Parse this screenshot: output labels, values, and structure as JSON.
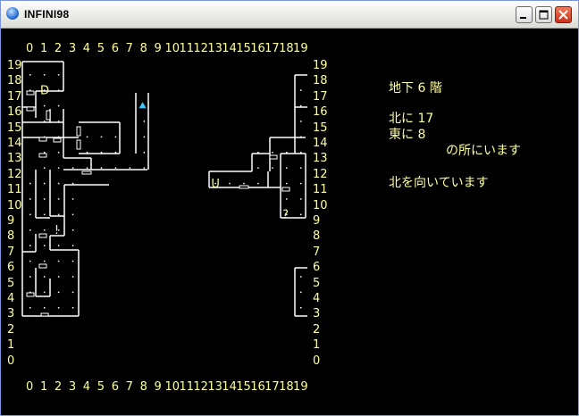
{
  "window": {
    "title": "INFINI98"
  },
  "colors": {
    "text": "#ffffa0",
    "wall": "#ffffff",
    "background": "#000000",
    "player": "#40c8ff"
  },
  "map": {
    "col_labels": [
      "0",
      "1",
      "2",
      "3",
      "4",
      "5",
      "6",
      "7",
      "8",
      "9",
      "10",
      "11",
      "12",
      "13",
      "14",
      "15",
      "16",
      "17",
      "18",
      "19"
    ],
    "row_labels": [
      "19",
      "18",
      "17",
      "16",
      "15",
      "14",
      "13",
      "12",
      "11",
      "10",
      "9",
      "8",
      "7",
      "6",
      "5",
      "4",
      "3",
      "2",
      "1",
      "0"
    ],
    "markers": [
      {
        "char": "D",
        "col": 1,
        "row": 18
      },
      {
        "char": "U",
        "col": 13,
        "row": 12
      },
      {
        "char": "?",
        "col": 18,
        "row": 10
      },
      {
        "char": "!",
        "col": 2,
        "row": 9
      }
    ],
    "player": {
      "col": 8,
      "row": 16,
      "facing": "north",
      "icon": "triangle-up"
    }
  },
  "status": {
    "floor": "地下 6 階",
    "north": "北に 17",
    "east": "東に 8",
    "location_suffix": "の所にいます",
    "facing": "北を向いています"
  }
}
